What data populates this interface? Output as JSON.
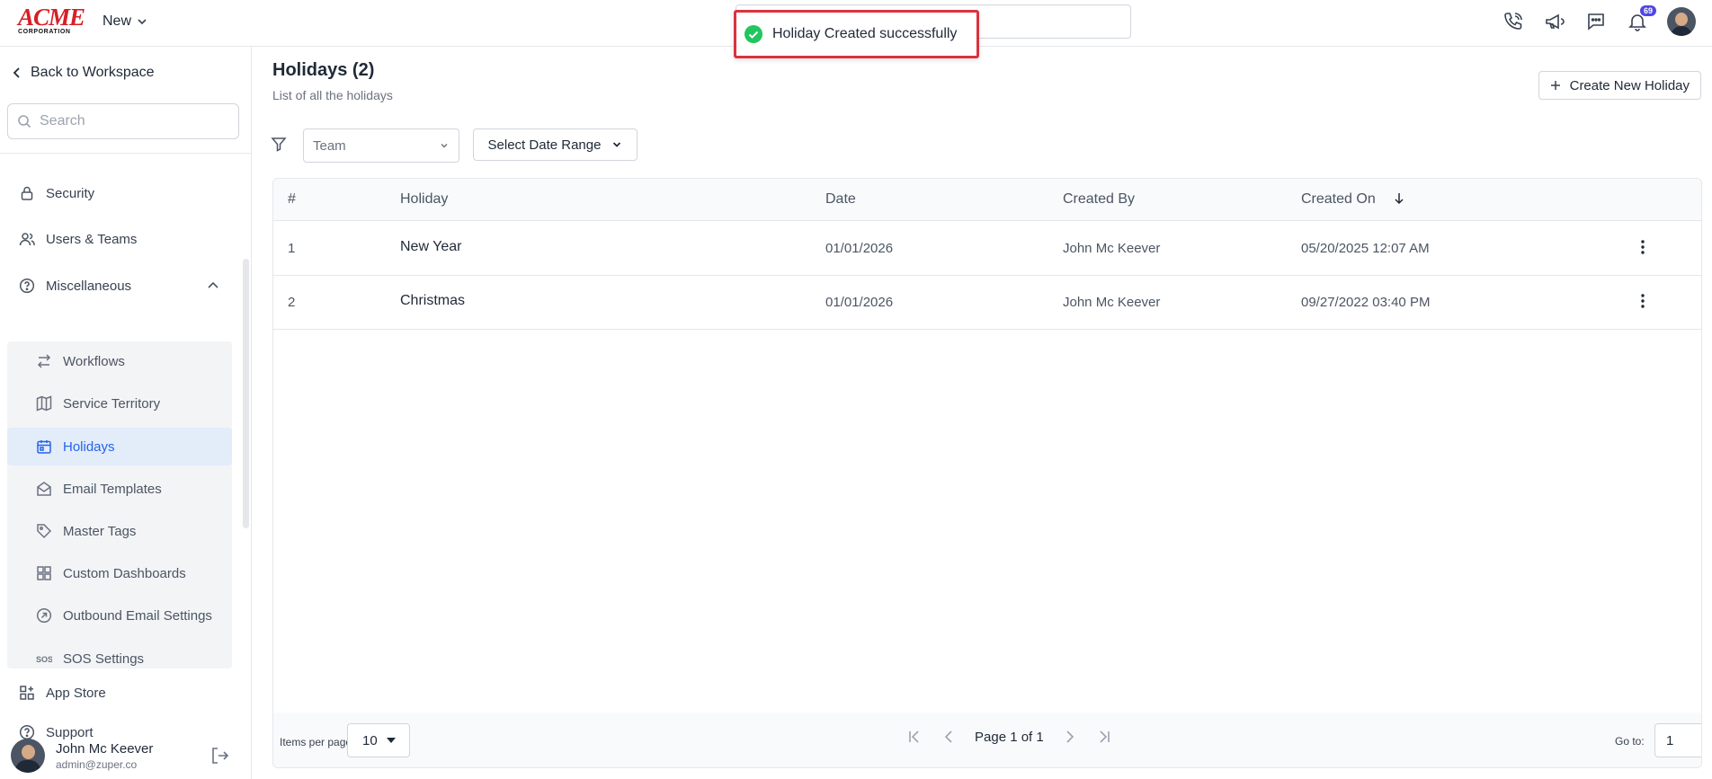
{
  "header": {
    "logo_text": "ACME",
    "logo_sub": "CORPORATION",
    "new_label": "New",
    "notification_count": "69"
  },
  "toast": {
    "message": "Holiday Created successfully"
  },
  "sidebar": {
    "back_label": "Back to Workspace",
    "search_placeholder": "Search",
    "items": [
      {
        "label": "Security"
      },
      {
        "label": "Users & Teams"
      },
      {
        "label": "Miscellaneous"
      }
    ],
    "sub_items": [
      {
        "label": "Workflows"
      },
      {
        "label": "Service Territory"
      },
      {
        "label": "Holidays"
      },
      {
        "label": "Email Templates"
      },
      {
        "label": "Master Tags"
      },
      {
        "label": "Custom Dashboards"
      },
      {
        "label": "Outbound Email Settings"
      },
      {
        "label": "SOS Settings"
      }
    ],
    "bottom_items": [
      {
        "label": "App Store"
      },
      {
        "label": "Support"
      }
    ],
    "user": {
      "name": "John Mc Keever",
      "email": "admin@zuper.co"
    }
  },
  "main": {
    "title": "Holidays (2)",
    "subtitle": "List of all the holidays",
    "create_label": "Create New Holiday",
    "team_filter": "Team",
    "date_range_label": "Select Date Range",
    "table": {
      "columns": [
        "#",
        "Holiday",
        "Date",
        "Created By",
        "Created On"
      ],
      "rows": [
        {
          "num": "1",
          "holiday": "New Year",
          "date": "01/01/2026",
          "created_by": "John Mc Keever",
          "created_on": "05/20/2025 12:07 AM"
        },
        {
          "num": "2",
          "holiday": "Christmas",
          "date": "01/01/2026",
          "created_by": "John Mc Keever",
          "created_on": "09/27/2022 03:40 PM"
        }
      ]
    },
    "footer": {
      "items_per_page_label": "Items per page",
      "items_per_page": "10",
      "page_text": "Page 1 of 1",
      "goto_label": "Go to:",
      "goto_value": "1"
    }
  },
  "colors": {
    "accent": "#2563eb",
    "brand": "#d71f26",
    "toast_border": "#d9333d",
    "success": "#22c55e"
  }
}
